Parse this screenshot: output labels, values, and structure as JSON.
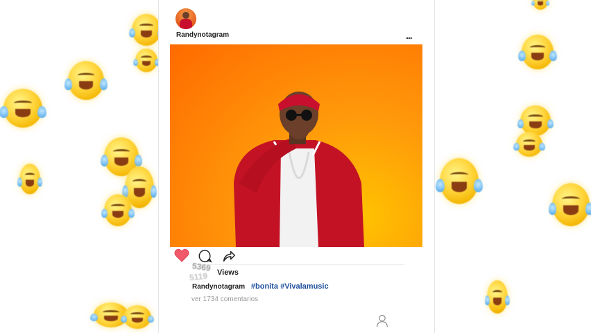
{
  "post": {
    "username": "Randynotagram",
    "more_label": "...",
    "views_count": "5369",
    "views_count_prev": "5119",
    "views_label": "Views",
    "caption_user": "Randynotagram",
    "hashtags": "#bonita #Vivalamusic",
    "comments_link": "ver 1734 comentarios"
  },
  "colors": {
    "heart": "#f05a6a",
    "hashtag": "#1f4e9c",
    "photo_bg": "#ff7a00"
  },
  "icons": [
    "heart-icon",
    "comment-icon",
    "share-icon",
    "profile-icon",
    "more-icon"
  ]
}
